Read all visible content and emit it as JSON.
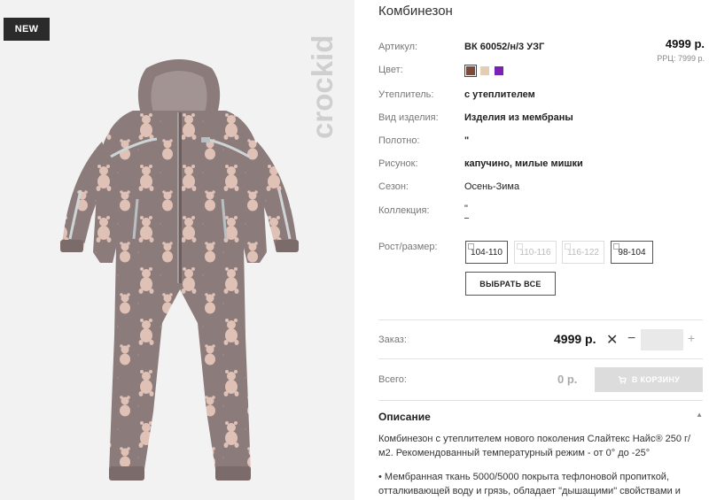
{
  "image": {
    "badge": "NEW",
    "brand": "crockid"
  },
  "product": {
    "title": "Комбинезон",
    "price": "4999 р.",
    "rrc": "РРЦ: 7999 р."
  },
  "specs": {
    "article": {
      "label": "Артикул:",
      "value": "ВК 60052/н/3 УЗГ"
    },
    "color": {
      "label": "Цвет:"
    },
    "insulation": {
      "label": "Утеплитель:",
      "value": "с утеплителем"
    },
    "kind": {
      "label": "Вид изделия:",
      "value": "Изделия из мембраны"
    },
    "fabric": {
      "label": "Полотно:",
      "value": "\""
    },
    "pattern": {
      "label": "Рисунок:",
      "value": "капучино, милые мишки"
    },
    "season": {
      "label": "Сезон:",
      "value": "Осень-Зима"
    },
    "collection": {
      "label": "Коллекция:",
      "value": "\""
    },
    "size": {
      "label": "Рост/размер:"
    }
  },
  "colors": [
    "#7a4a3a",
    "#e2cdb5",
    "#7a22b3"
  ],
  "sizes": [
    {
      "label": "104-110",
      "available": true
    },
    {
      "label": "110-116",
      "available": false
    },
    {
      "label": "116-122",
      "available": false
    },
    {
      "label": "98-104",
      "available": true
    }
  ],
  "select_all": "ВЫБРАТЬ ВСЕ",
  "order": {
    "label": "Заказ:",
    "price": "4999 р.",
    "x": "✕",
    "minus": "−",
    "plus": "+"
  },
  "total": {
    "label": "Всего:",
    "price": "0 р."
  },
  "cart_button": "В КОРЗИНУ",
  "description": {
    "title": "Описание",
    "caret": "▲",
    "p1": "Комбинезон с утеплителем нового поколения Слайтекс Найс® 250 г/м2. Рекомендованный температурный режим - от 0° до -25°",
    "p2": "• Мембранная ткань 5000/5000 покрыта тефлоновой пропиткой, отталкивающей воду и грязь, обладает \"дышащими\" свойствами и"
  }
}
